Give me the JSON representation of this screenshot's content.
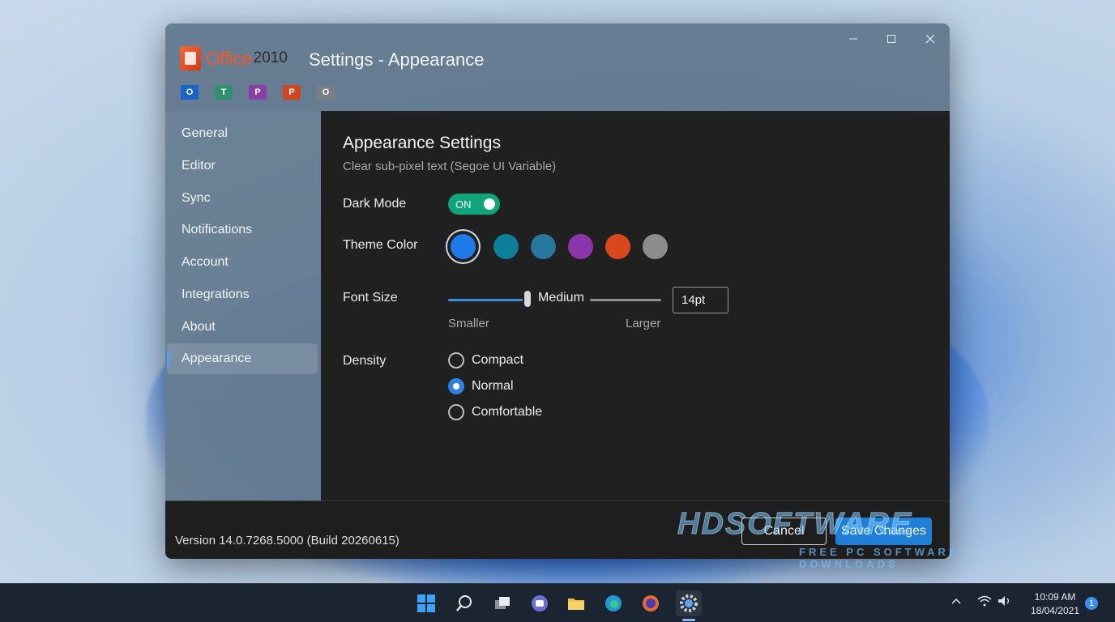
{
  "window": {
    "title": "Settings - Appearance",
    "logo_word": "Office",
    "logo_year": "2010",
    "controls": {
      "minimize": "minimize-icon",
      "maximize": "maximize-icon",
      "close": "close-icon"
    },
    "app_icons": [
      {
        "name": "outlook-icon",
        "letter": "O",
        "color": "#1b63c6"
      },
      {
        "name": "teams-icon",
        "letter": "T",
        "color": "#2f8f6f"
      },
      {
        "name": "publisher-icon",
        "letter": "P",
        "color": "#8a3ea8"
      },
      {
        "name": "powerpoint-icon",
        "letter": "P",
        "color": "#d2461f"
      },
      {
        "name": "office-icon",
        "letter": "O",
        "color": "#7a7f86"
      }
    ]
  },
  "sidebar": {
    "items": [
      {
        "label": "General",
        "active": false
      },
      {
        "label": "Editor",
        "active": false
      },
      {
        "label": "Sync",
        "active": false
      },
      {
        "label": "Notifications",
        "active": false
      },
      {
        "label": "Account",
        "active": false
      },
      {
        "label": "Integrations",
        "active": false
      },
      {
        "label": "About",
        "active": false
      },
      {
        "label": "Appearance",
        "active": true
      }
    ]
  },
  "main": {
    "title": "Appearance Settings",
    "subtitle": "Clear sub-pixel text (Segoe UI Variable)",
    "dark_mode": {
      "label": "Dark Mode",
      "state": "ON",
      "on": true
    },
    "theme_color": {
      "label": "Theme Color",
      "colors": [
        "#1e7ae6",
        "#0c7f9a",
        "#25779e",
        "#8b35aa",
        "#d9481c",
        "#8c8c8c"
      ],
      "selected_index": 0
    },
    "font_size": {
      "label": "Font Size",
      "current_label": "Medium",
      "min_label": "Smaller",
      "max_label": "Larger",
      "value": "14pt",
      "level": 0.5
    },
    "density": {
      "label": "Density",
      "options": [
        "Compact",
        "Normal",
        "Comfortable"
      ],
      "selected": "Normal"
    }
  },
  "footer": {
    "version": "Version 14.0.7268.5000 (Build 20260615)",
    "cancel_label": "Cancel",
    "save_label": "Save Changes"
  },
  "watermark": {
    "main": "HDSOFTWARE",
    "sub": "FREE PC SOFTWARE DOWNLOADS"
  },
  "taskbar": {
    "icons": [
      "windows-start-icon",
      "search-icon",
      "task-view-icon",
      "chat-icon",
      "file-explorer-icon",
      "edge-icon",
      "firefox-icon",
      "settings-icon"
    ],
    "active_icon": "settings-icon",
    "time": "10:09 AM",
    "date": "18/04/2021",
    "notification_count": "1",
    "accent": "#3b8fe8"
  }
}
